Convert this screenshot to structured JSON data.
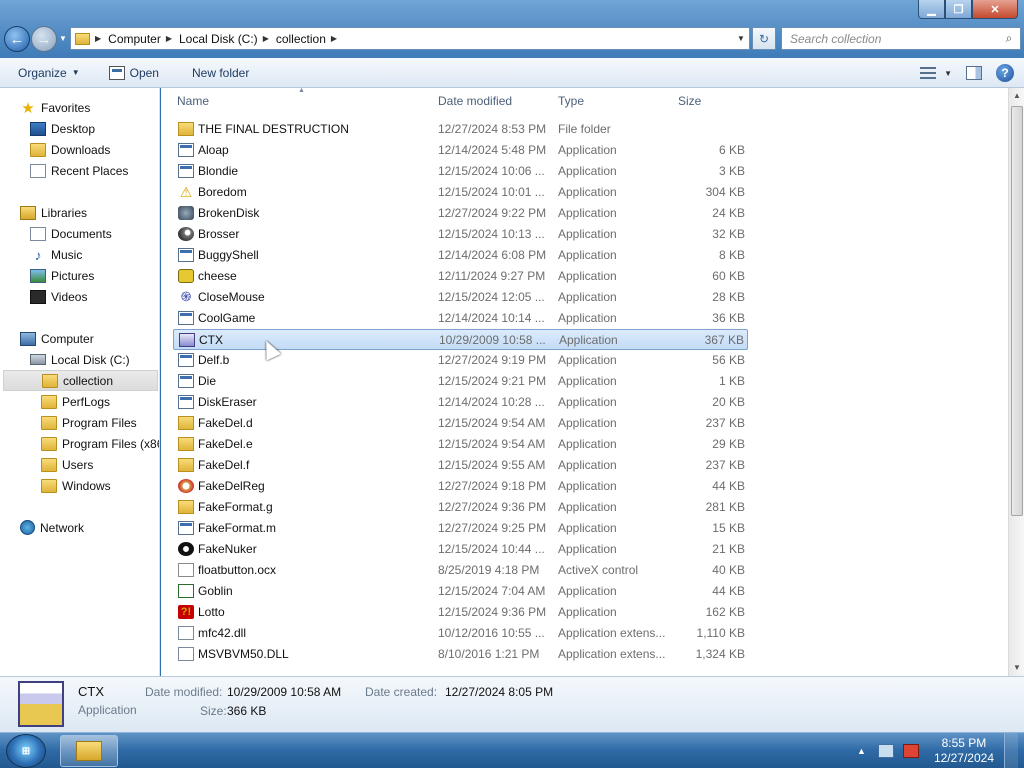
{
  "window": {
    "minimize_label": "▁",
    "maximize_label": "❐",
    "close_label": "✕"
  },
  "address": {
    "crumbs": [
      "Computer",
      "Local Disk (C:)",
      "collection"
    ]
  },
  "search": {
    "placeholder": "Search collection"
  },
  "toolbar": {
    "organize": "Organize",
    "open": "Open",
    "new_folder": "New folder"
  },
  "nav": {
    "favorites": "Favorites",
    "desktop": "Desktop",
    "downloads": "Downloads",
    "recent": "Recent Places",
    "libraries": "Libraries",
    "documents": "Documents",
    "music": "Music",
    "pictures": "Pictures",
    "videos": "Videos",
    "computer": "Computer",
    "local_disk": "Local Disk (C:)",
    "collection": "collection",
    "perflogs": "PerfLogs",
    "program_files": "Program Files",
    "program_files_x86": "Program Files (x86)",
    "users": "Users",
    "windows": "Windows",
    "network": "Network"
  },
  "columns": {
    "name": "Name",
    "date": "Date modified",
    "type": "Type",
    "size": "Size"
  },
  "files": [
    {
      "name": "THE FINAL DESTRUCTION",
      "date": "12/27/2024 8:53 PM",
      "type": "File folder",
      "size": "",
      "icon": "folder-icon"
    },
    {
      "name": "Aloap",
      "date": "12/14/2024 5:48 PM",
      "type": "Application",
      "size": "6 KB",
      "icon": "app-icon"
    },
    {
      "name": "Blondie",
      "date": "12/15/2024 10:06 ...",
      "type": "Application",
      "size": "3 KB",
      "icon": "app-icon"
    },
    {
      "name": "Boredom",
      "date": "12/15/2024 10:01 ...",
      "type": "Application",
      "size": "304 KB",
      "icon": "warning-icon"
    },
    {
      "name": "BrokenDisk",
      "date": "12/27/2024 9:22 PM",
      "type": "Application",
      "size": "24 KB",
      "icon": "disk-icon"
    },
    {
      "name": "Brosser",
      "date": "12/15/2024 10:13 ...",
      "type": "Application",
      "size": "32 KB",
      "icon": "lens-icon"
    },
    {
      "name": "BuggyShell",
      "date": "12/14/2024 6:08 PM",
      "type": "Application",
      "size": "8 KB",
      "icon": "app-icon"
    },
    {
      "name": "cheese",
      "date": "12/11/2024 9:27 PM",
      "type": "Application",
      "size": "60 KB",
      "icon": "cheese-icon"
    },
    {
      "name": "CloseMouse",
      "date": "12/15/2024 12:05 ...",
      "type": "Application",
      "size": "28 KB",
      "icon": "mouse-icon"
    },
    {
      "name": "CoolGame",
      "date": "12/14/2024 10:14 ...",
      "type": "Application",
      "size": "36 KB",
      "icon": "app-icon"
    },
    {
      "name": "CTX",
      "date": "10/29/2009 10:58 ...",
      "type": "Application",
      "size": "367 KB",
      "icon": "ctx-icon"
    },
    {
      "name": "Delf.b",
      "date": "12/27/2024 9:19 PM",
      "type": "Application",
      "size": "56 KB",
      "icon": "app-icon"
    },
    {
      "name": "Die",
      "date": "12/15/2024 9:21 PM",
      "type": "Application",
      "size": "1 KB",
      "icon": "app-icon"
    },
    {
      "name": "DiskEraser",
      "date": "12/14/2024 10:28 ...",
      "type": "Application",
      "size": "20 KB",
      "icon": "app-icon"
    },
    {
      "name": "FakeDel.d",
      "date": "12/15/2024 9:54 AM",
      "type": "Application",
      "size": "237 KB",
      "icon": "fakedel-icon"
    },
    {
      "name": "FakeDel.e",
      "date": "12/15/2024 9:54 AM",
      "type": "Application",
      "size": "29 KB",
      "icon": "fakedel-icon"
    },
    {
      "name": "FakeDel.f",
      "date": "12/15/2024 9:55 AM",
      "type": "Application",
      "size": "237 KB",
      "icon": "fakedel-icon"
    },
    {
      "name": "FakeDelReg",
      "date": "12/27/2024 9:18 PM",
      "type": "Application",
      "size": "44 KB",
      "icon": "reg-icon"
    },
    {
      "name": "FakeFormat.g",
      "date": "12/27/2024 9:36 PM",
      "type": "Application",
      "size": "281 KB",
      "icon": "fakedel-icon"
    },
    {
      "name": "FakeFormat.m",
      "date": "12/27/2024 9:25 PM",
      "type": "Application",
      "size": "15 KB",
      "icon": "app-icon"
    },
    {
      "name": "FakeNuker",
      "date": "12/15/2024 10:44 ...",
      "type": "Application",
      "size": "21 KB",
      "icon": "nuke-icon"
    },
    {
      "name": "floatbutton.ocx",
      "date": "8/25/2019 4:18 PM",
      "type": "ActiveX control",
      "size": "40 KB",
      "icon": "ocx-icon"
    },
    {
      "name": "Goblin",
      "date": "12/15/2024 7:04 AM",
      "type": "Application",
      "size": "44 KB",
      "icon": "goblin-icon"
    },
    {
      "name": "Lotto",
      "date": "12/15/2024 9:36 PM",
      "type": "Application",
      "size": "162 KB",
      "icon": "lotto-icon"
    },
    {
      "name": "mfc42.dll",
      "date": "10/12/2016 10:55 ...",
      "type": "Application extens...",
      "size": "1,110 KB",
      "icon": "dll-icon"
    },
    {
      "name": "MSVBVM50.DLL",
      "date": "8/10/2016 1:21 PM",
      "type": "Application extens...",
      "size": "1,324 KB",
      "icon": "dll-icon"
    }
  ],
  "selected_index": 10,
  "details": {
    "name": "CTX",
    "type": "Application",
    "date_modified_label": "Date modified:",
    "date_modified": "10/29/2009 10:58 AM",
    "date_created_label": "Date created:",
    "date_created": "12/27/2024 8:05 PM",
    "size_label": "Size:",
    "size": "366 KB"
  },
  "taskbar": {
    "time": "8:55 PM",
    "date": "12/27/2024"
  }
}
